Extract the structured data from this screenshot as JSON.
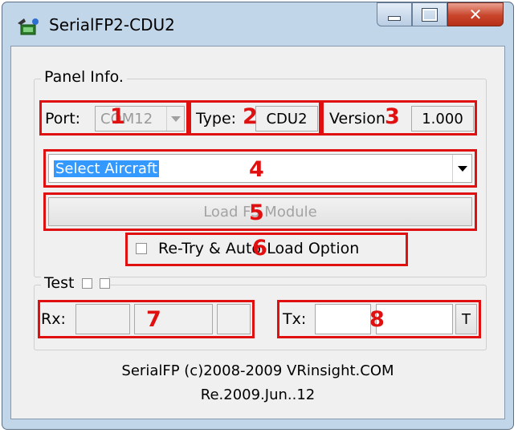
{
  "window": {
    "title": "SerialFP2-CDU2"
  },
  "panel_info": {
    "legend": "Panel Info.",
    "port_label": "Port:",
    "port_value": "COM12",
    "type_label": "Type:",
    "type_value": "CDU2",
    "version_label": "Version",
    "version_value": "1.000",
    "aircraft_selected": "Select Aircraft",
    "load_button": "Load FS Module",
    "retry_label": "Re-Try & Auto-Load Option"
  },
  "test": {
    "legend": "Test",
    "rx_label": "Rx:",
    "tx_label": "Tx:",
    "t_button": "T"
  },
  "footer": {
    "line1": "SerialFP (c)2008-2009 VRinsight.COM",
    "line2": "Re.2009.Jun..12"
  },
  "annotations": [
    "1",
    "2",
    "3",
    "4",
    "5",
    "6",
    "7",
    "8"
  ],
  "colors": {
    "annotation": "#e01010",
    "selection": "#3399ff",
    "frame": "#c2d6ea"
  }
}
